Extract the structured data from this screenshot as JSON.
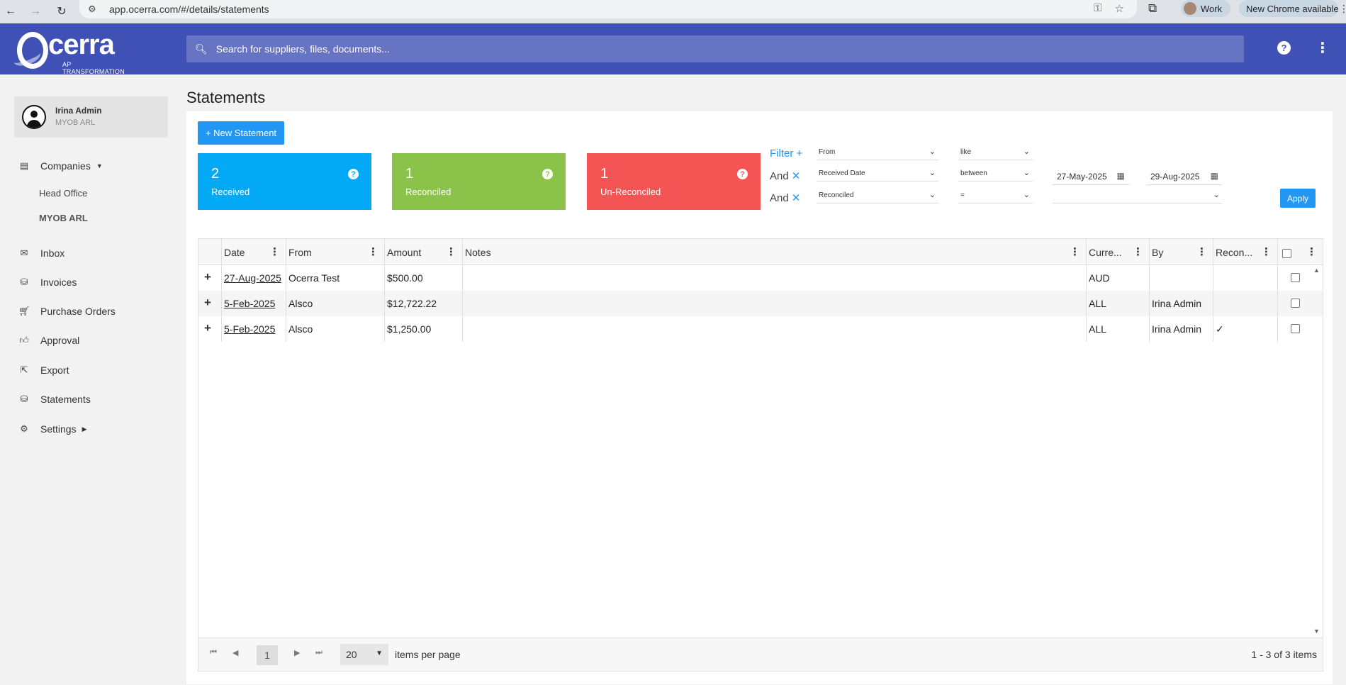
{
  "browser": {
    "url": "app.ocerra.com/#/details/statements",
    "profile_label": "Work",
    "update_label": "New Chrome available"
  },
  "header": {
    "logo_text": "Ocerra",
    "logo_tagline": "AP TRANSFORMATION",
    "search_placeholder": "Search for suppliers, files, documents..."
  },
  "user": {
    "name": "Irina Admin",
    "org": "MYOB ARL"
  },
  "sidebar": {
    "companies_label": "Companies",
    "companies": [
      "Head Office",
      "MYOB ARL"
    ],
    "items": [
      {
        "label": "Inbox"
      },
      {
        "label": "Invoices"
      },
      {
        "label": "Purchase Orders"
      },
      {
        "label": "Approval"
      },
      {
        "label": "Export"
      },
      {
        "label": "Statements"
      },
      {
        "label": "Settings"
      }
    ]
  },
  "page": {
    "title": "Statements",
    "new_button": "+ New Statement"
  },
  "tiles": {
    "received": {
      "count": "2",
      "label": "Received"
    },
    "reconciled": {
      "count": "1",
      "label": "Reconciled"
    },
    "unreconciled": {
      "count": "1",
      "label": "Un-Reconciled"
    }
  },
  "filters": {
    "title": "Filter +",
    "and_label": "And",
    "rows": [
      {
        "field": "From",
        "op": "like"
      },
      {
        "field": "Received Date",
        "op": "between",
        "date_from": "27-May-2025",
        "date_to": "29-Aug-2025"
      },
      {
        "field": "Reconciled",
        "op": "=",
        "value": ""
      }
    ],
    "apply_label": "Apply"
  },
  "grid": {
    "columns": [
      "Date",
      "From",
      "Amount",
      "Notes",
      "Curre...",
      "By",
      "Recon..."
    ],
    "rows": [
      {
        "date": "27-Aug-2025",
        "from": "Ocerra Test",
        "amount": "$500.00",
        "notes": "",
        "currency": "AUD",
        "by": "",
        "reconciled": ""
      },
      {
        "date": "5-Feb-2025",
        "from": "Alsco",
        "amount": "$12,722.22",
        "notes": "",
        "currency": "ALL",
        "by": "Irina Admin",
        "reconciled": ""
      },
      {
        "date": "5-Feb-2025",
        "from": "Alsco",
        "amount": "$1,250.00",
        "notes": "",
        "currency": "ALL",
        "by": "Irina Admin",
        "reconciled": "✓"
      }
    ]
  },
  "pager": {
    "current_page": "1",
    "page_size": "20",
    "page_size_label": "items per page",
    "info": "1 - 3 of 3 items"
  }
}
